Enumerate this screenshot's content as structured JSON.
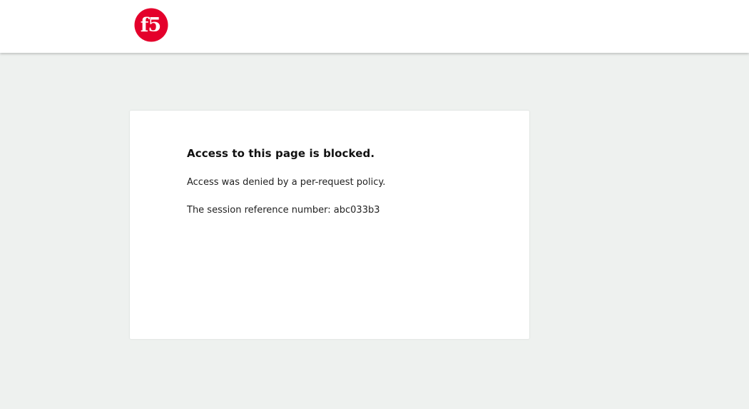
{
  "header": {
    "logo_icon": "f5-logo-icon",
    "logo_text": "f5",
    "brand_color": "#e4002b"
  },
  "message": {
    "title": "Access to this page is blocked.",
    "denied_text": "Access was denied by a per-request policy.",
    "session_label": "The session reference number: ",
    "session_number": "abc033b3"
  },
  "colors": {
    "page_background": "#eef1ef",
    "card_background": "#ffffff",
    "header_background": "#ffffff"
  }
}
